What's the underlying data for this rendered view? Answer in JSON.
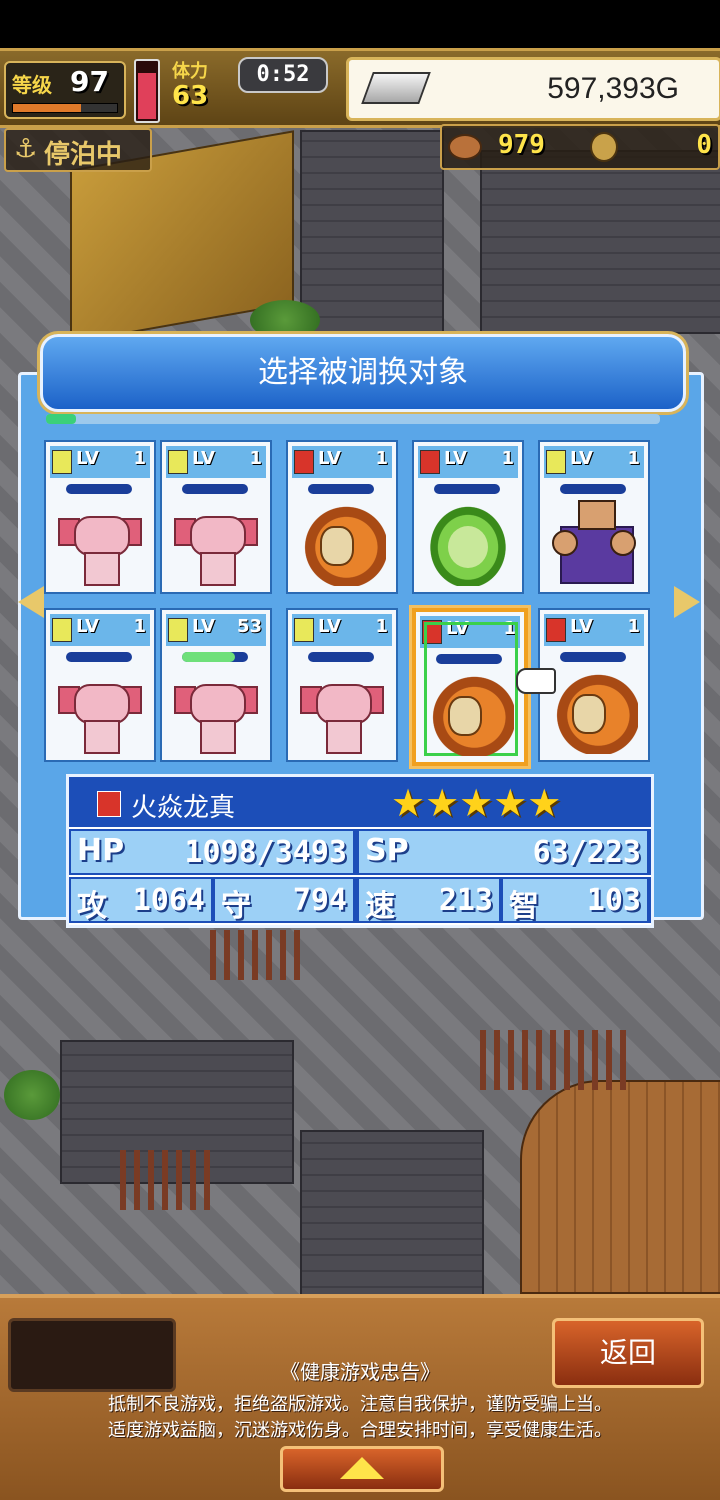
{
  "hud": {
    "level_label": "等级",
    "level_value": "97",
    "stamina_label": "体力",
    "stamina_value": "63",
    "timer": "0:52",
    "gold": "597,393G",
    "anchor_icon": "⚓",
    "anchor_status": "停泊中",
    "resource_a": "979",
    "resource_b": "0",
    "icons": [
      "silver-ingot-icon",
      "anchor-icon",
      "meat-icon",
      "coin-icon"
    ]
  },
  "dialog": {
    "title": "选择被调换对象",
    "cards": [
      {
        "element": "light",
        "lv_label": "LV",
        "level": "1",
        "hp_fill": 0,
        "creature": "axolotl"
      },
      {
        "element": "light",
        "lv_label": "LV",
        "level": "1",
        "hp_fill": 0,
        "creature": "axolotl"
      },
      {
        "element": "fire",
        "lv_label": "LV",
        "level": "1",
        "hp_fill": 0,
        "creature": "fire-dragon"
      },
      {
        "element": "fire",
        "lv_label": "LV",
        "level": "1",
        "hp_fill": 0,
        "creature": "green-frog"
      },
      {
        "element": "light",
        "lv_label": "LV",
        "level": "1",
        "hp_fill": 0,
        "creature": "purple-bruiser"
      },
      {
        "element": "light",
        "lv_label": "LV",
        "level": "1",
        "hp_fill": 0,
        "creature": "axolotl"
      },
      {
        "element": "light",
        "lv_label": "LV",
        "level": "53",
        "hp_fill": 0.8,
        "creature": "axolotl"
      },
      {
        "element": "light",
        "lv_label": "LV",
        "level": "1",
        "hp_fill": 0,
        "creature": "axolotl"
      },
      {
        "element": "fire",
        "lv_label": "LV",
        "level": "1",
        "hp_fill": 0,
        "creature": "fire-dragon",
        "selected": true
      },
      {
        "element": "fire",
        "lv_label": "LV",
        "level": "1",
        "hp_fill": 0,
        "creature": "fire-dragon"
      }
    ],
    "selected_unit": {
      "name": "火焱龙真",
      "stars": "★★★★★",
      "star_count": 5,
      "hp_label": "HP",
      "hp_value": "1098/3493",
      "sp_label": "SP",
      "sp_value": "63/223",
      "atk_label": "攻",
      "atk_value": "1064",
      "def_label": "守",
      "def_value": "794",
      "spd_label": "速",
      "spd_value": "213",
      "int_label": "智",
      "int_value": "103"
    }
  },
  "bottom": {
    "return_label": "返回",
    "notice_title": "《健康游戏忠告》",
    "notice_line1": "抵制不良游戏，拒绝盗版游戏。注意自我保护，谨防受骗上当。",
    "notice_line2": "适度游戏益脑，沉迷游戏伤身。合理安排时间，享受健康生活。"
  }
}
